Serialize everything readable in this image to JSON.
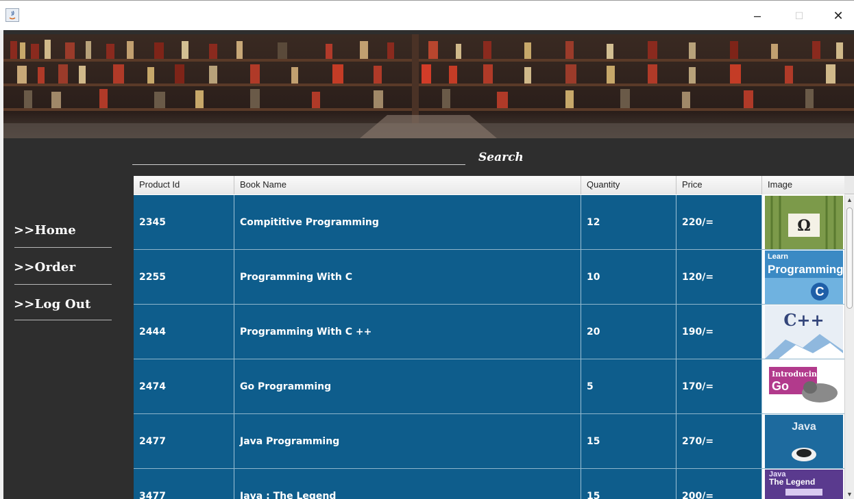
{
  "window": {
    "minimize": "–",
    "maximize": "☐",
    "close": "✕"
  },
  "sidebar": {
    "items": [
      {
        "label": ">>Home"
      },
      {
        "label": ">>Order"
      },
      {
        "label": ">>Log Out"
      }
    ]
  },
  "search": {
    "label": "Search"
  },
  "table": {
    "headers": [
      "Product Id",
      "Book Name",
      "Quantity",
      "Price",
      "Image"
    ],
    "rows": [
      {
        "id": "2345",
        "name": "Compititive Programming",
        "qty": "12",
        "price": "220/="
      },
      {
        "id": "2255",
        "name": "Programming With C",
        "qty": "10",
        "price": "120/="
      },
      {
        "id": "2444",
        "name": "Programming With C ++",
        "qty": "20",
        "price": "190/="
      },
      {
        "id": "2474",
        "name": " Go Programming",
        "qty": "5",
        "price": "170/="
      },
      {
        "id": "2477",
        "name": " Java Programming",
        "qty": "15",
        "price": "270/="
      },
      {
        "id": "3477",
        "name": " Java : The Legend",
        "qty": "15",
        "price": "200/="
      }
    ]
  },
  "covers": {
    "c1": "Ω",
    "c2a": "Learn",
    "c2b": "Programming",
    "c2c": "C",
    "c3": "C++",
    "c4a": "Introducing",
    "c4b": "Go",
    "c5": "Java",
    "c6a": "Java",
    "c6b": "The Legend"
  },
  "colors": {
    "row_bg": "#0e5d8c",
    "sidebar_bg": "#2e2e2e"
  }
}
